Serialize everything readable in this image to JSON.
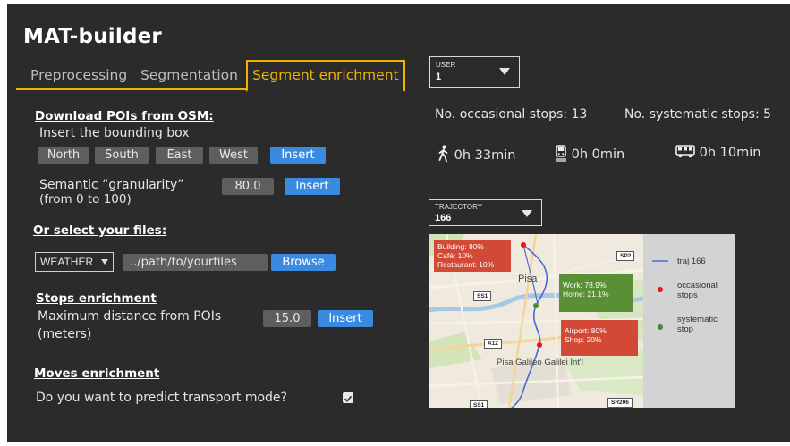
{
  "app": {
    "title": "MAT-builder"
  },
  "tabs": [
    {
      "label": "Preprocessing"
    },
    {
      "label": "Segmentation"
    },
    {
      "label": "Segment enrichment",
      "active": true
    }
  ],
  "download_pois": {
    "title": "Download POIs from OSM:",
    "instruction": "Insert the bounding box",
    "bbox_fields": [
      "North",
      "South",
      "East",
      "West"
    ],
    "insert_label": "Insert",
    "granularity_label": "Semantic “granularity”",
    "granularity_range": "(from 0 to 100)",
    "granularity_value": "80.0",
    "granularity_insert": "Insert"
  },
  "select_files": {
    "title": "Or select your files:",
    "type_select": "WEATHER",
    "path": "../path/to/yourfiles",
    "browse_label": "Browse"
  },
  "stops_enrichment": {
    "title": "Stops enrichment",
    "label": "Maximum distance from POIs",
    "unit": "(meters)",
    "value": "15.0",
    "insert_label": "Insert"
  },
  "moves_enrichment": {
    "title": "Moves enrichment",
    "question": "Do you want to predict transport mode?",
    "checked": true
  },
  "user_select": {
    "label": "USER",
    "value": "1"
  },
  "stats": {
    "occasional": "No. occasional stops: 13",
    "systematic": "No. systematic stops: 5"
  },
  "modes": [
    {
      "icon": "walking-icon",
      "value": "0h 33min"
    },
    {
      "icon": "train-icon",
      "value": "0h 0min"
    },
    {
      "icon": "bus-icon",
      "value": "0h 10min"
    }
  ],
  "trajectory_select": {
    "label": "TRAJECTORY",
    "value": "166"
  },
  "map": {
    "city_label": "Pisa",
    "airport_label": "Pisa Galileo Galilei Int'l",
    "roads": [
      "SP2",
      "SS1",
      "A12",
      "SS1",
      "SR206"
    ],
    "callouts": [
      {
        "lines": [
          "Building: 80%",
          "Café: 10%",
          "Restaurant: 10%"
        ],
        "color": "#d24a35"
      },
      {
        "lines": [
          "Work: 78.9%",
          "Home: 21.1%"
        ],
        "color": "#5a8f35"
      },
      {
        "lines": [
          "Airport: 80%",
          "Shop: 20%"
        ],
        "color": "#d24a35"
      }
    ],
    "colors": {
      "trajectory": "#4a6bd4",
      "occasional": "#e8141a",
      "systematic": "#4a8a2f"
    }
  },
  "legend": [
    {
      "label": "traj 166",
      "marker": "line"
    },
    {
      "label": "occasional stops",
      "marker": "red-dot"
    },
    {
      "label": "systematic stop",
      "marker": "green-dot"
    }
  ]
}
